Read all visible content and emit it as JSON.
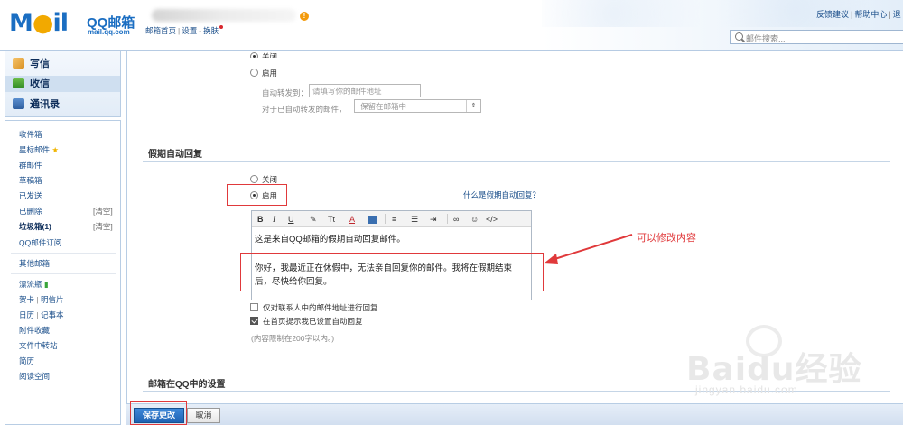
{
  "header": {
    "logo_mail": "Mail",
    "logo_qq": "QQ邮箱",
    "logo_domain": "mail.qq.com",
    "links": [
      "邮箱首页",
      "设置",
      "换肤"
    ],
    "right_links": [
      "反馈建议",
      "帮助中心",
      "退"
    ],
    "search_placeholder": "邮件搜索..."
  },
  "sidebar": {
    "main": [
      {
        "label": "写信",
        "icon": "pencil-icon"
      },
      {
        "label": "收信",
        "icon": "inbox-icon"
      },
      {
        "label": "通讯录",
        "icon": "contacts-icon"
      }
    ],
    "folders": [
      {
        "label": "收件箱"
      },
      {
        "label": "星标邮件",
        "icon": "star-icon"
      },
      {
        "label": "群邮件"
      },
      {
        "label": "草稿箱"
      },
      {
        "label": "已发送"
      },
      {
        "label": "已删除",
        "action": "[清空]"
      },
      {
        "label": "垃圾箱(1)",
        "action": "[清空]"
      },
      {
        "label": "QQ邮件订阅"
      }
    ],
    "other": "其他邮箱",
    "apps": [
      "漂流瓶",
      "贺卡",
      "明信片",
      "日历",
      "记事本",
      "附件收藏",
      "文件中转站",
      "简历",
      "阅读空间"
    ]
  },
  "forward": {
    "option_off": "关闭",
    "option_on": "启用",
    "forward_to_label": "自动转发到：",
    "forward_to_placeholder": "请填写你的邮件地址",
    "after_label": "对于已自动转发的邮件，",
    "after_value": "保留在邮箱中"
  },
  "vacation": {
    "title": "假期自动回复",
    "option_off": "关闭",
    "option_on": "启用",
    "selected": "启用",
    "help_link": "什么是假期自动回复？",
    "toolbar": [
      "B",
      "I",
      "U",
      "Tt",
      "A",
      "≡",
      "☺",
      "</>"
    ],
    "body_line1": "这是来自QQ邮箱的假期自动回复邮件。",
    "body_line2": "你好，我最近正在休假中，无法亲自回复你的邮件。我将在假期结束后，尽快给你回复。",
    "opt_contacts_only": "仅对联系人中的邮件地址进行回复",
    "opt_contacts_only_checked": false,
    "opt_show_home": "在首页提示我已设置自动回复",
    "opt_show_home_checked": true,
    "limit_note": "(内容限制在200字以内。)"
  },
  "annotation": "可以修改内容",
  "section2_title": "邮箱在QQ中的设置",
  "buttons": {
    "save": "保存更改",
    "cancel": "取消"
  },
  "watermark": {
    "main": "Baidu经验",
    "sub": "jingyan.baidu.com"
  },
  "colors": {
    "accent": "#1e62b3",
    "annotation": "#e0393b"
  }
}
